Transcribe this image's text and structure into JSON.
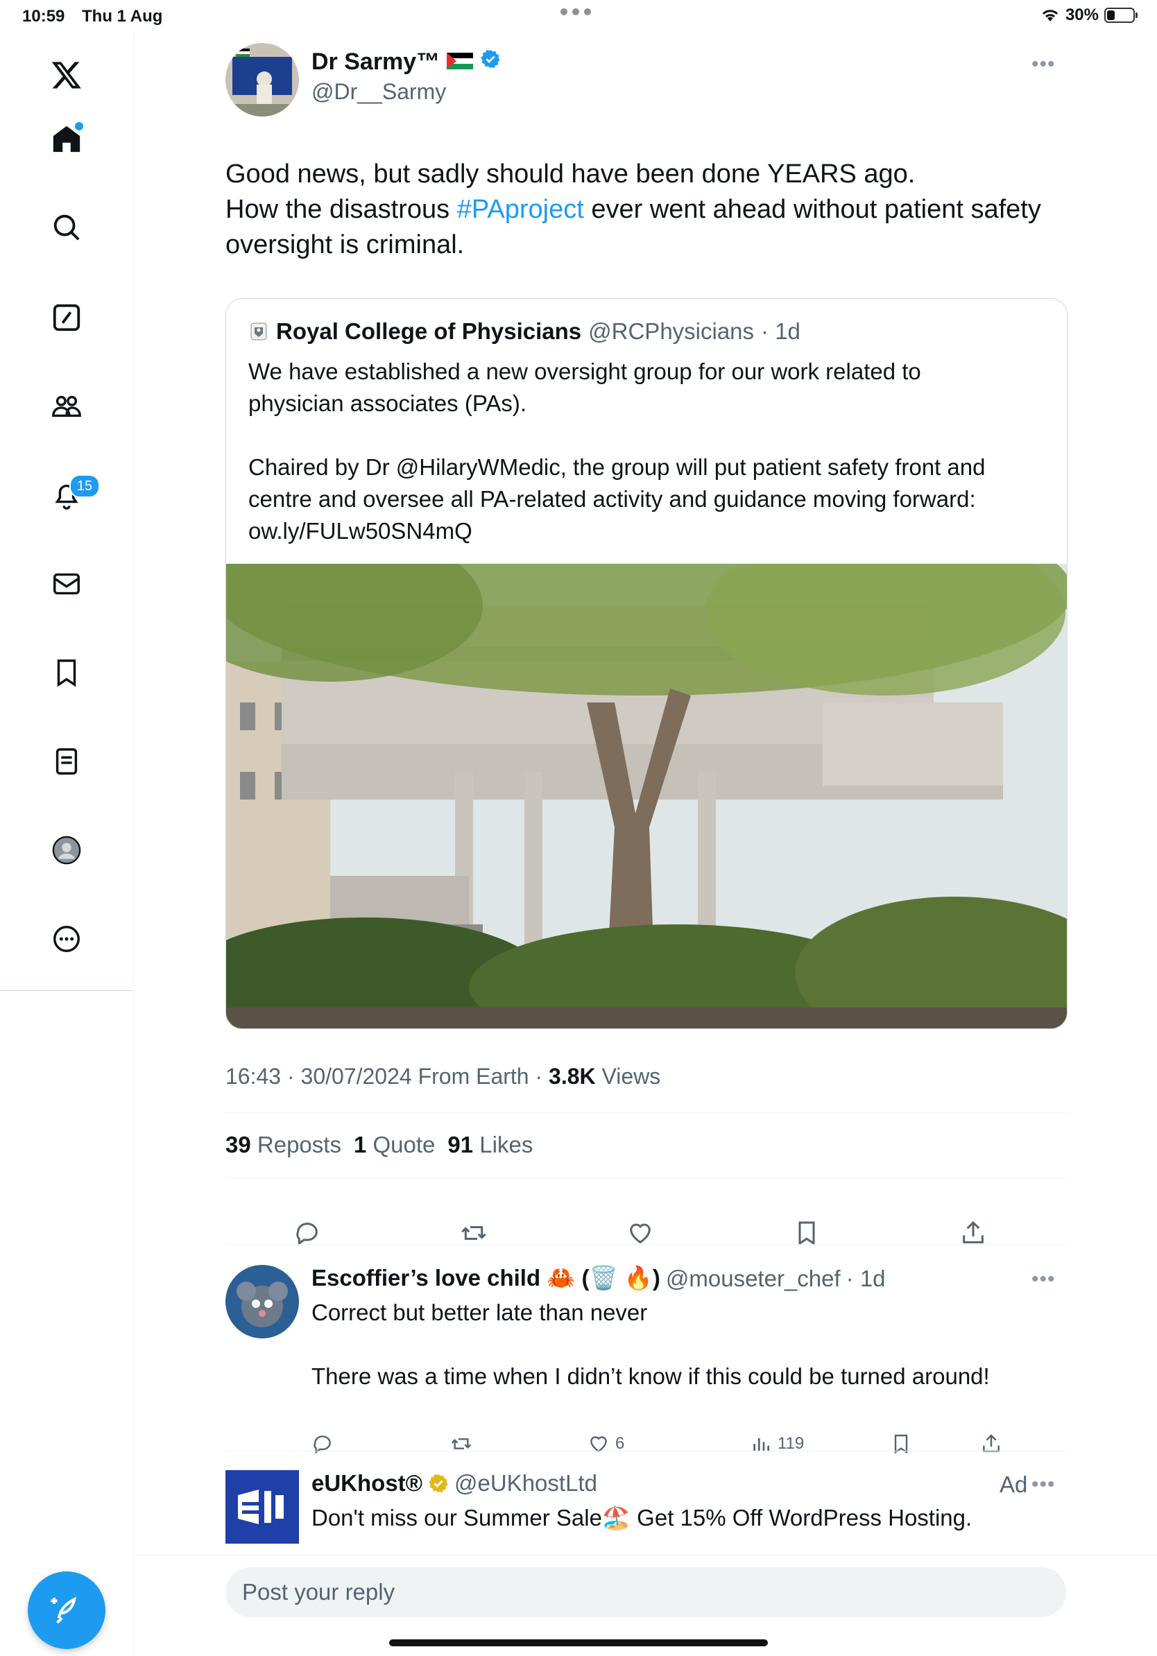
{
  "status_bar": {
    "time": "10:59",
    "date": "Thu 1 Aug",
    "battery": "30%",
    "battery_level": 0.3
  },
  "sidebar": {
    "items": [
      {
        "name": "home",
        "icon": "home-icon"
      },
      {
        "name": "explore",
        "icon": "search-icon"
      },
      {
        "name": "grok",
        "icon": "grok-icon"
      },
      {
        "name": "communities",
        "icon": "communities-icon"
      },
      {
        "name": "notifications",
        "icon": "bell-icon",
        "badge": "15"
      },
      {
        "name": "messages",
        "icon": "mail-icon"
      },
      {
        "name": "bookmarks",
        "icon": "bookmark-icon"
      },
      {
        "name": "lists",
        "icon": "list-icon"
      },
      {
        "name": "profile",
        "icon": "profile-icon"
      },
      {
        "name": "more",
        "icon": "more-circle-icon"
      }
    ],
    "compose_icon": "compose-icon"
  },
  "tweet": {
    "author_name": "Dr Sarmy™",
    "author_flag": "🇵🇸",
    "author_handle": "@Dr__Sarmy",
    "text_line1": "Good news, but sadly should have been done YEARS ago.",
    "text_line2_a": "How the disastrous ",
    "hashtag": "#PAproject",
    "text_line2_b": " ever went ahead without patient safety",
    "text_line3": "oversight is criminal.",
    "quote": {
      "name": "Royal College of Physicians",
      "handle": "@RCPhysicians",
      "time": "· 1d",
      "text": "We have established a new oversight group for our work related to\nphysician associates (PAs).\n\nChaired by Dr @HilaryWMedic, the group will put patient safety front and\ncentre and oversee all PA-related activity and guidance moving forward:\now.ly/FULw50SN4mQ"
    },
    "meta_time": "16:43 · 30/07/2024 From Earth · ",
    "views_count": "3.8K",
    "views_label": " Views",
    "reposts_count": "39",
    "reposts_label": "Reposts",
    "quotes_count": "1",
    "quotes_label": "Quote",
    "likes_count": "91",
    "likes_label": "Likes"
  },
  "reply": {
    "name": "Escoffier’s love child 🦀 (🗑️ 🔥)",
    "handle": "@mouseter_chef",
    "time": "· 1d",
    "text": "Correct but better late than never\n\nThere was a time when I didn’t know if this could be turned around!",
    "likes": "6",
    "views": "119"
  },
  "ad": {
    "name": "eUKhost®",
    "handle": "@eUKhostLtd",
    "label": "Ad",
    "text": "Don't miss our Summer Sale🏖️ Get 15% Off WordPress Hosting."
  },
  "reply_box": {
    "placeholder": "Post your reply"
  }
}
